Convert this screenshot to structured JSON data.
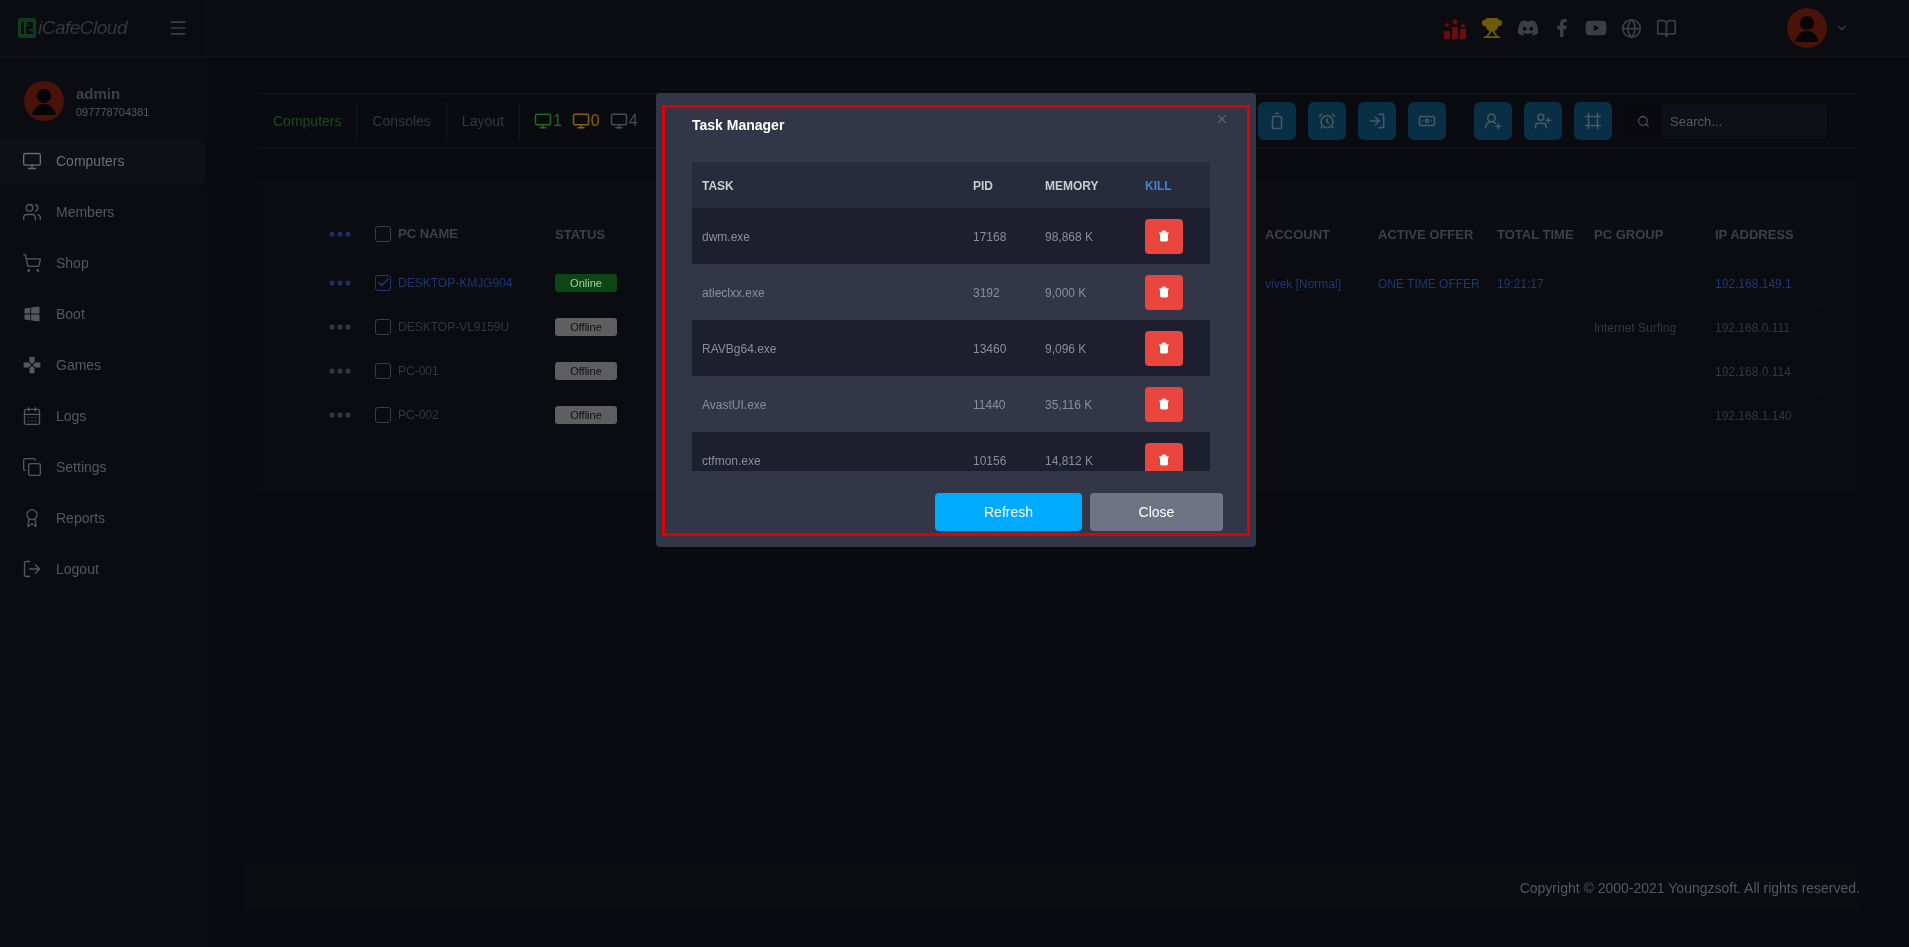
{
  "logo": {
    "text": "iCafeCloud"
  },
  "user": {
    "name": "admin",
    "phone": "097778704381"
  },
  "sidebar": {
    "items": [
      {
        "label": "Computers",
        "selected": true
      },
      {
        "label": "Members",
        "selected": false
      },
      {
        "label": "Shop",
        "selected": false
      },
      {
        "label": "Boot",
        "selected": false
      },
      {
        "label": "Games",
        "selected": false
      },
      {
        "label": "Logs",
        "selected": false
      },
      {
        "label": "Settings",
        "selected": false
      },
      {
        "label": "Reports",
        "selected": false
      },
      {
        "label": "Logout",
        "selected": false
      }
    ]
  },
  "tabs": [
    {
      "label": "Computers",
      "selected": true
    },
    {
      "label": "Consoles",
      "selected": false
    },
    {
      "label": "Layout",
      "selected": false
    }
  ],
  "pc_counts": [
    {
      "count": "1",
      "color": "#1f6b22"
    },
    {
      "count": "0",
      "color": "#8a6206"
    },
    {
      "count": "4",
      "color": "#4a4d54"
    }
  ],
  "search": {
    "placeholder": "Search..."
  },
  "table": {
    "header_checked": false,
    "columns": [
      "PC NAME",
      "STATUS",
      "ACCOUNT",
      "ACTIVE OFFER",
      "TOTAL TIME",
      "PC GROUP",
      "IP ADDRESS"
    ],
    "rows": [
      {
        "pc_name": "DESKTOP-KMJG904",
        "checked": true,
        "status": {
          "label": "Online",
          "kind": "online"
        },
        "account": "vivek [Normal]",
        "active_offer": "ONE TIME OFFER",
        "total_time": "19:21:17",
        "ip_address": "192.168.149.1"
      },
      {
        "pc_name": "DESKTOP-VL9159U",
        "checked": false,
        "status": {
          "label": "Offline",
          "kind": "offline"
        },
        "pc_group": "Internet Surfing",
        "ip_address": "192.168.0.111"
      },
      {
        "pc_name": "PC-001",
        "checked": false,
        "status": {
          "label": "Offline",
          "kind": "offline"
        },
        "ip_address": "192.168.0.114"
      },
      {
        "pc_name": "PC-002",
        "checked": false,
        "status": {
          "label": "Offline",
          "kind": "offline"
        },
        "ip_address": "192.168.1.140"
      }
    ]
  },
  "modal": {
    "title": "Task Manager",
    "columns": [
      "TASK",
      "PID",
      "MEMORY",
      "KILL"
    ],
    "rows": [
      {
        "task": "dwm.exe",
        "pid": "17168",
        "memory": "98,868 K"
      },
      {
        "task": "atieclxx.exe",
        "pid": "3192",
        "memory": "9,000 K"
      },
      {
        "task": "RAVBg64.exe",
        "pid": "13460",
        "memory": "9,096 K"
      },
      {
        "task": "AvastUI.exe",
        "pid": "11440",
        "memory": "35,116 K"
      },
      {
        "task": "ctfmon.exe",
        "pid": "10156",
        "memory": "14,812 K"
      }
    ],
    "buttons": [
      {
        "label": "Refresh",
        "kind": "primary"
      },
      {
        "label": "Close",
        "kind": "secondary"
      }
    ]
  },
  "footer": {
    "copyright": "Copyright © 2000-2021 Youngzsoft. All rights reserved."
  }
}
